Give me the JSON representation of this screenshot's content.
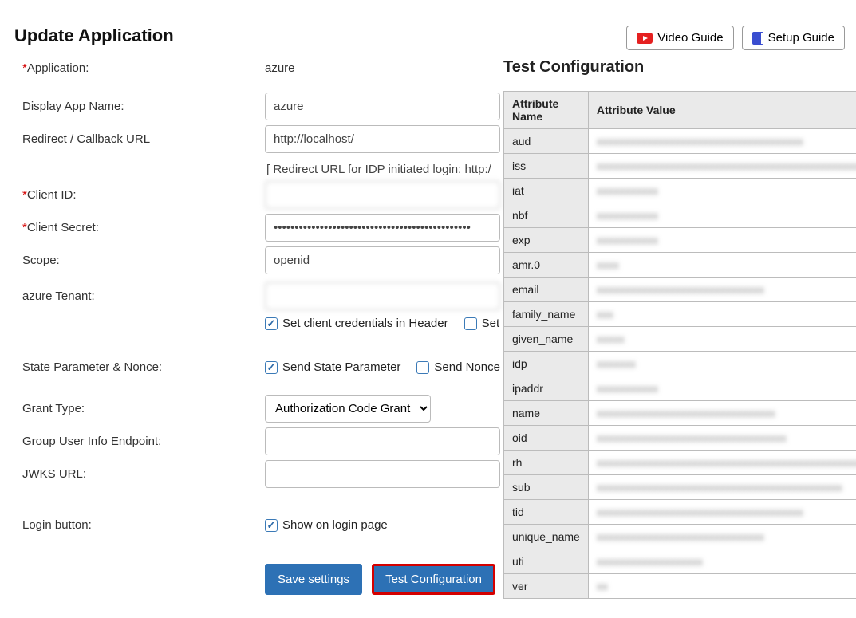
{
  "header": {
    "title": "Update Application",
    "video_btn": "Video Guide",
    "setup_btn": "Setup Guide"
  },
  "form": {
    "application_label": "Application:",
    "application_value": "azure",
    "display_name_label": "Display App Name:",
    "display_name_value": "azure",
    "redirect_label": "Redirect / Callback URL",
    "redirect_value": "http://localhost/",
    "redirect_hint": "[ Redirect URL for IDP initiated login: http:/",
    "client_id_label": "Client ID:",
    "client_id_value": "                         ",
    "client_secret_label": "Client Secret:",
    "client_secret_value": "•••••••••••••••••••••••••••••••••••••••••••••••",
    "scope_label": "Scope:",
    "scope_value": "openid",
    "tenant_label": "azure Tenant:",
    "tenant_value": "                         ",
    "cb_header_label": "Set client credentials in Header",
    "cb_body_label": "Set",
    "state_label": "State Parameter & Nonce:",
    "cb_state_label": "Send State Parameter",
    "cb_nonce_label": "Send Nonce",
    "grant_label": "Grant Type:",
    "grant_value": "Authorization Code Grant",
    "group_endpoint_label": "Group User Info Endpoint:",
    "group_endpoint_value": "",
    "jwks_label": "JWKS URL:",
    "jwks_value": "",
    "login_button_label": "Login button:",
    "cb_show_login_label": "Show on login page",
    "save_btn": "Save settings",
    "test_btn": "Test Configuration"
  },
  "test_panel": {
    "title": "Test Configuration",
    "col_name": "Attribute Name",
    "col_value": "Attribute Value",
    "rows": [
      {
        "name": "aud",
        "val": "xxxxxxxxxxxxxxxxxxxxxxxxxxxxxxxxxxxxx"
      },
      {
        "name": "iss",
        "val": "xxxxxxxxxxxxxxxxxxxxxxxxxxxxxxxxxxxxxxxxxxxxxxxxxxx"
      },
      {
        "name": "iat",
        "val": "xxxxxxxxxxx"
      },
      {
        "name": "nbf",
        "val": "xxxxxxxxxxx"
      },
      {
        "name": "exp",
        "val": "xxxxxxxxxxx"
      },
      {
        "name": "amr.0",
        "val": "xxxx"
      },
      {
        "name": "email",
        "val": "xxxxxxxxxxxxxxxxxxxxxxxxxxxxxx"
      },
      {
        "name": "family_name",
        "val": "xxx"
      },
      {
        "name": "given_name",
        "val": "xxxxx"
      },
      {
        "name": "idp",
        "val": "xxxxxxx"
      },
      {
        "name": "ipaddr",
        "val": "xxxxxxxxxxx"
      },
      {
        "name": "name",
        "val": "xxxxxxxxxxxxxxxxxxxxxxxxxxxxxxxx"
      },
      {
        "name": "oid",
        "val": "xxxxxxxxxxxxxxxxxxxxxxxxxxxxxxxxxx"
      },
      {
        "name": "rh",
        "val": "xxxxxxxxxxxxxxxxxxxxxxxxxxxxxxxxxxxxxxxxxxxxxxxxxx"
      },
      {
        "name": "sub",
        "val": "xxxxxxxxxxxxxxxxxxxxxxxxxxxxxxxxxxxxxxxxxxxx"
      },
      {
        "name": "tid",
        "val": "xxxxxxxxxxxxxxxxxxxxxxxxxxxxxxxxxxxxx"
      },
      {
        "name": "unique_name",
        "val": "xxxxxxxxxxxxxxxxxxxxxxxxxxxxxx"
      },
      {
        "name": "uti",
        "val": "xxxxxxxxxxxxxxxxxxx"
      },
      {
        "name": "ver",
        "val": "xx"
      }
    ]
  }
}
